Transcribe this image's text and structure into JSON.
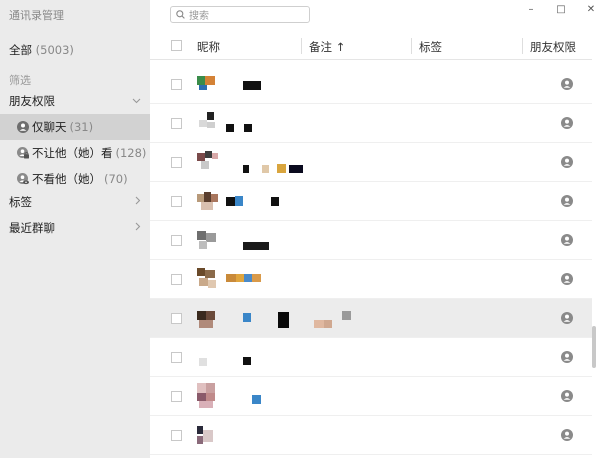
{
  "sidebar": {
    "title": "通讯录管理",
    "all_label": "全部",
    "all_count": "(5003)",
    "filter_label": "筛选",
    "friend_permission_label": "朋友权限",
    "sub_items": [
      {
        "label": "仅聊天",
        "count": "(31)"
      },
      {
        "label": "不让他（她）看",
        "count": "(128)"
      },
      {
        "label": "不看他（她）",
        "count": "(70)"
      }
    ],
    "tags_label": "标签",
    "recent_groups_label": "最近群聊"
  },
  "search": {
    "placeholder": "搜索"
  },
  "window_controls": {
    "minimize": "–",
    "maximize": "□",
    "close": "✕"
  },
  "table": {
    "columns": {
      "nickname": "昵称",
      "remark": "备注 ↑",
      "tags": "标签",
      "permission": "朋友权限"
    },
    "selected_row_index": 6,
    "row_count": 10
  },
  "colors": {
    "sidebar_bg": "#ebebeb",
    "sidebar_active": "#d2d2d2",
    "row_selected": "#ececec",
    "permission_icon": "#8a8a8a"
  }
}
